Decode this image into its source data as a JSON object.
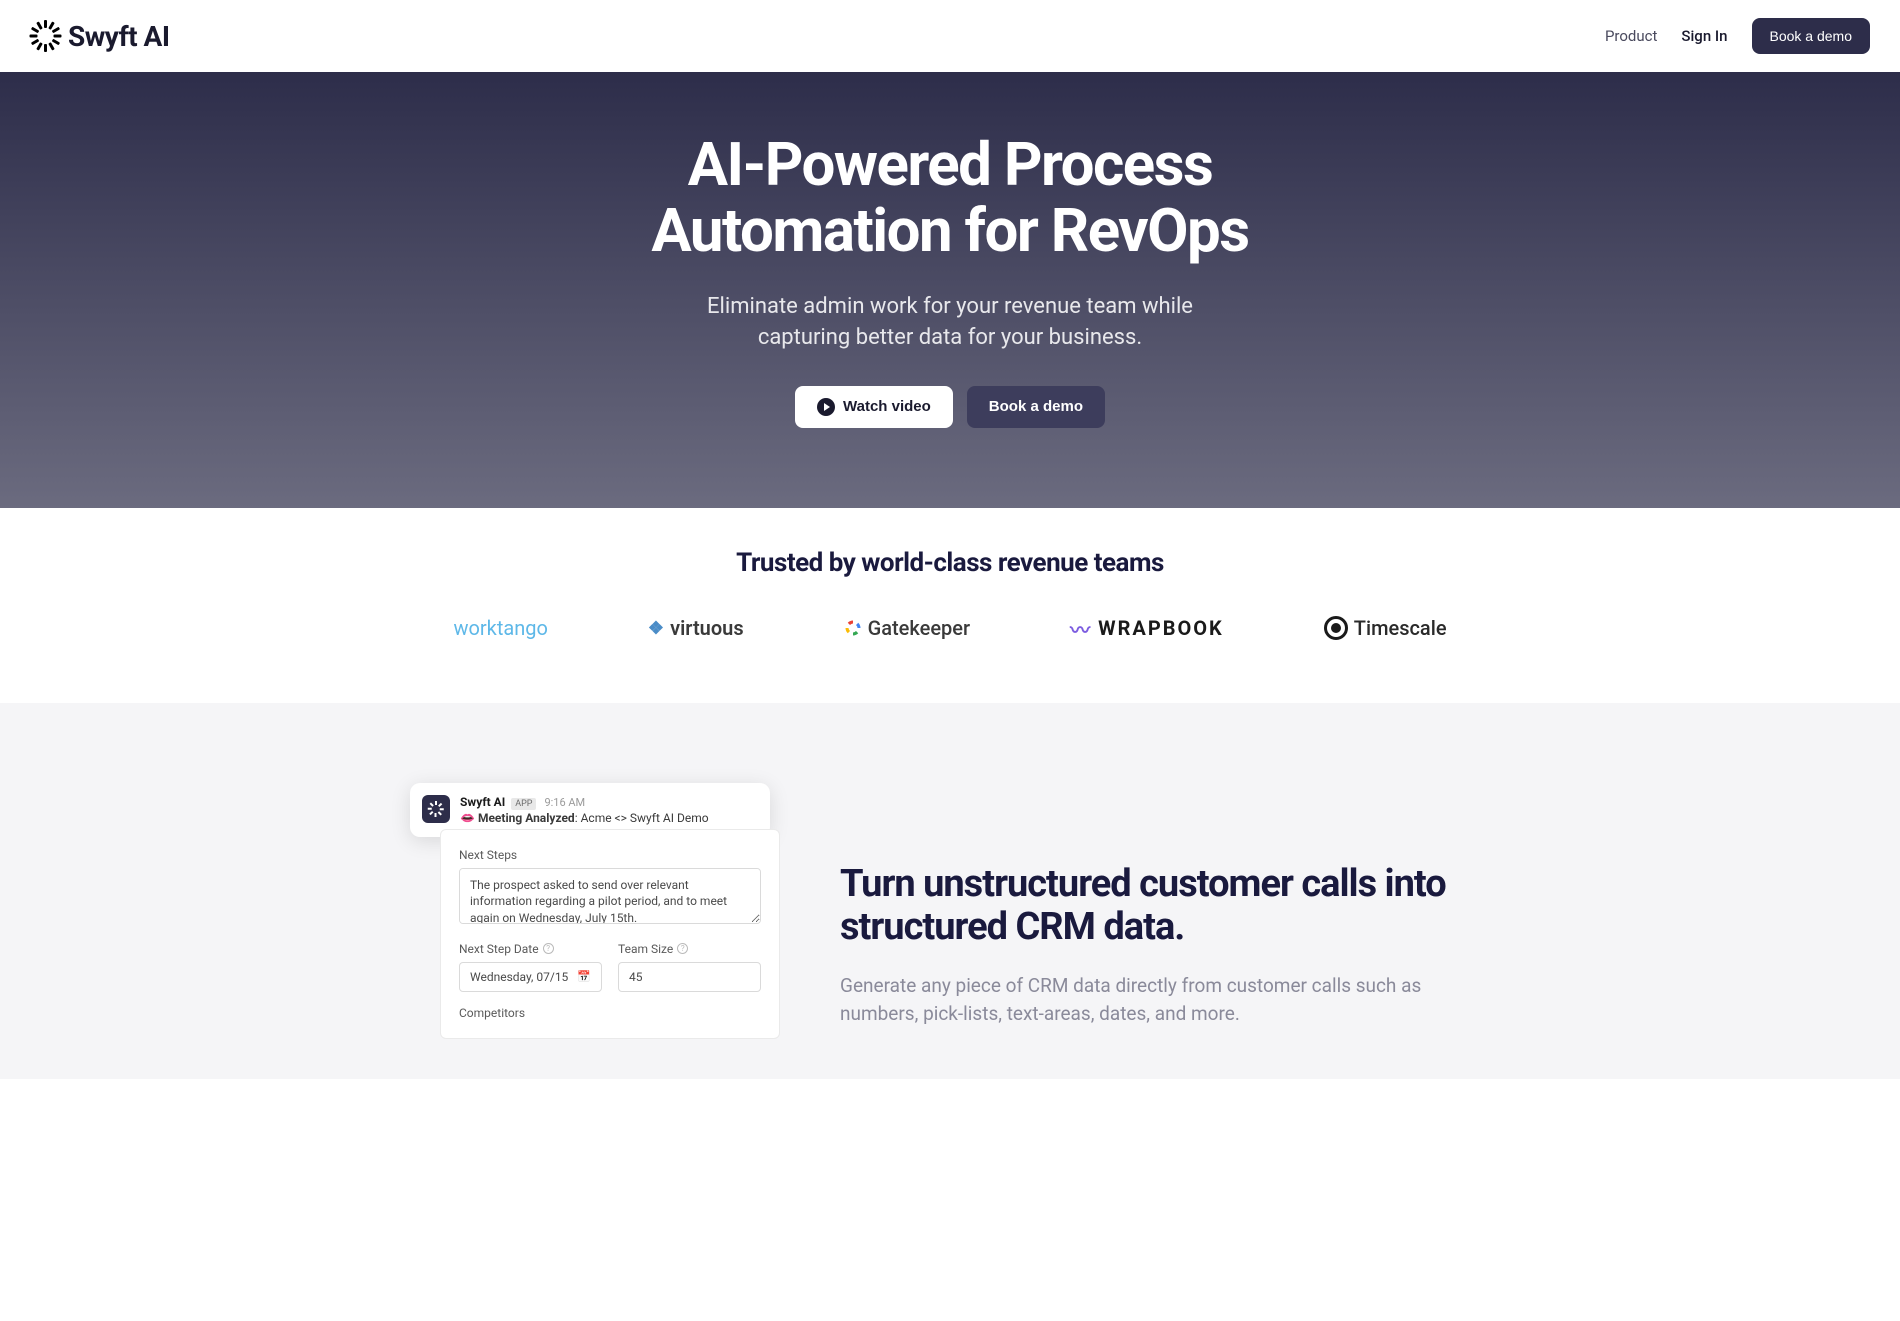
{
  "nav": {
    "brand": "Swyft AI",
    "product": "Product",
    "signin": "Sign In",
    "book_demo": "Book a demo"
  },
  "hero": {
    "headline_l1": "AI-Powered Process",
    "headline_l2": "Automation for RevOps",
    "subhead_l1": "Eliminate admin work for your revenue team while",
    "subhead_l2": "capturing better data for your business.",
    "watch_video": "Watch video",
    "book_demo": "Book a demo"
  },
  "trusted": {
    "heading": "Trusted by world-class revenue teams",
    "logos": {
      "worktango": "worktango",
      "virtuous": "virtuous",
      "gatekeeper": "Gatekeeper",
      "wrapbook": "WRAPBOOK",
      "timescale": "Timescale"
    }
  },
  "feature": {
    "heading": "Turn unstructured customer calls into structured CRM data.",
    "body": "Generate any piece of CRM data directly from customer calls such as numbers, pick-lists, text-areas, dates, and more."
  },
  "slack": {
    "name": "Swyft AI",
    "badge": "APP",
    "time": "9:16 AM",
    "emoji": "👄",
    "title_bold": "Meeting Analyzed",
    "title_rest": ": Acme <> Swyft AI Demo"
  },
  "form": {
    "next_steps_label": "Next Steps",
    "next_steps_value": "The prospect asked to send over relevant information regarding a pilot period, and to meet again on Wednesday, July 15th.",
    "next_step_date_label": "Next Step Date",
    "next_step_date_value": "Wednesday, 07/15",
    "team_size_label": "Team Size",
    "team_size_value": "45",
    "competitors_label": "Competitors"
  }
}
